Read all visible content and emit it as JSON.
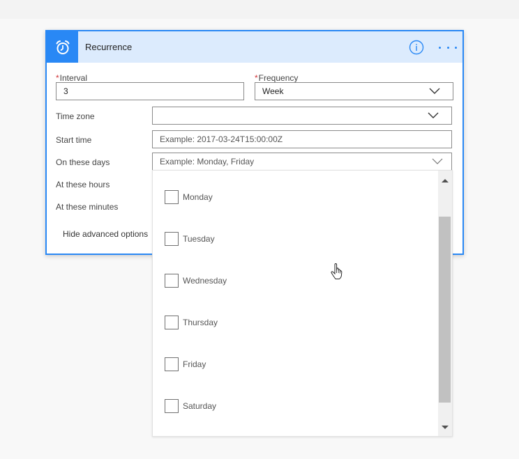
{
  "card": {
    "title": "Recurrence",
    "header_icon": "alarm-clock-icon",
    "info_icon": "info-icon",
    "more_icon": "more-options-icon",
    "accent_color": "#2988f5",
    "header_bg_color": "#dcebfd"
  },
  "fields": {
    "interval": {
      "label": "Interval",
      "required_marker": "*",
      "value": "3"
    },
    "frequency": {
      "label": "Frequency",
      "required_marker": "*",
      "value": "Week"
    },
    "time_zone": {
      "label": "Time zone",
      "value": ""
    },
    "start_time": {
      "label": "Start time",
      "placeholder": "Example: 2017-03-24T15:00:00Z"
    },
    "on_these_days": {
      "label": "On these days",
      "placeholder": "Example: Monday, Friday"
    },
    "at_these_hours": {
      "label": "At these hours"
    },
    "at_these_minutes": {
      "label": "At these minutes"
    }
  },
  "advanced_toggle": {
    "label": "Hide advanced options"
  },
  "days_dropdown": {
    "options": [
      {
        "label": "Monday",
        "checked": false
      },
      {
        "label": "Tuesday",
        "checked": false
      },
      {
        "label": "Wednesday",
        "checked": false
      },
      {
        "label": "Thursday",
        "checked": false
      },
      {
        "label": "Friday",
        "checked": false
      },
      {
        "label": "Saturday",
        "checked": false
      }
    ]
  }
}
